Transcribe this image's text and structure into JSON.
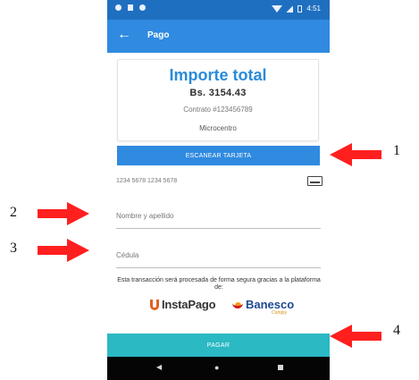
{
  "status_bar": {
    "time": "4:51",
    "icons": [
      "gear-icon",
      "square-icon",
      "notification-icon",
      "wifi-icon",
      "signal-icon",
      "battery-icon"
    ]
  },
  "app_bar": {
    "back_icon": "arrow-left-icon",
    "title": "Pago"
  },
  "payment_summary": {
    "title": "Importe total",
    "amount": "Bs. 3154.43",
    "contract": "Contrato #123456789",
    "service": "Microcentro"
  },
  "card_scan": {
    "button_label": "ESCANEAR TARJETA",
    "card_numbers": "1234 5678 1234 5678",
    "card_icon": "credit-card-icon"
  },
  "form": {
    "name_placeholder": "Nombre y apellido",
    "id_placeholder": "Cédula"
  },
  "disclaimer": "Esta transacción será procesada de forma segura gracias a la plataforma de:",
  "brands": {
    "instapago": "InstaPago",
    "banesco": "Banesco",
    "banesco_subtitle": "Comlpy"
  },
  "pay_button_label": "PAGAR",
  "navigation_bar": {
    "back": "◀",
    "home": "●",
    "recent": "■"
  },
  "annotations": {
    "labels": [
      "1",
      "2",
      "3",
      "4"
    ],
    "arrow_color": "#ff1f1f"
  },
  "colors": {
    "status_bar": "#1f6fc0",
    "app_bar": "#2f8ae0",
    "accent_text": "#2a8bd8",
    "pay_button": "#2bb9c3"
  }
}
